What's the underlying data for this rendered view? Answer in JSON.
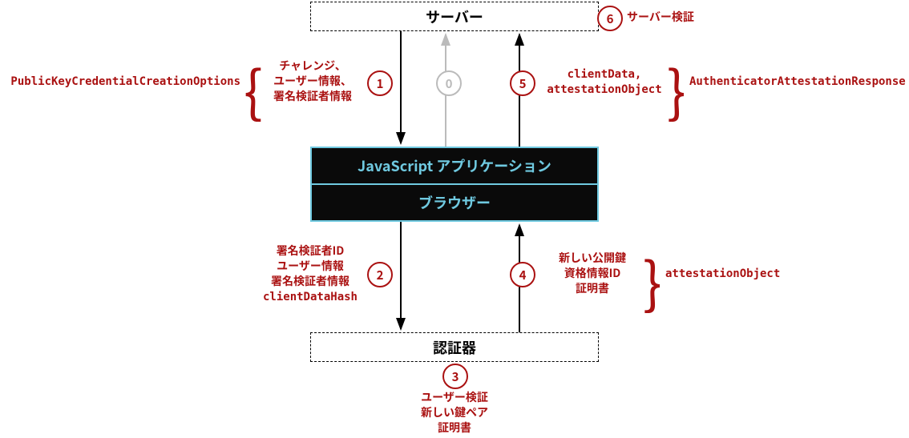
{
  "nodes": {
    "server": "サーバー",
    "js_app": "JavaScript アプリケーション",
    "browser": "ブラウザー",
    "authenticator": "認証器"
  },
  "steps": {
    "s0": "0",
    "s1": "1",
    "s2": "2",
    "s3": "3",
    "s4": "4",
    "s5": "5",
    "s6": "6"
  },
  "labels": {
    "step6": "サーバー検証",
    "step1_line1": "チャレンジ、",
    "step1_line2": "ユーザー情報、",
    "step1_line3": "署名検証者情報",
    "step1_code": "PublicKeyCredentialCreationOptions",
    "step5_line1": "clientData,",
    "step5_line2": "attestationObject",
    "step5_code": "AuthenticatorAttestationResponse",
    "step2_line1": "署名検証者ID",
    "step2_line2": "ユーザー情報",
    "step2_line3": "署名検証者情報",
    "step2_line4": "clientDataHash",
    "step4_line1": "新しい公開鍵",
    "step4_line2": "資格情報ID",
    "step4_line3": "証明書",
    "step4_code": "attestationObject",
    "step3_line1": "ユーザー検証",
    "step3_line2": "新しい鍵ペア",
    "step3_line3": "証明書"
  }
}
